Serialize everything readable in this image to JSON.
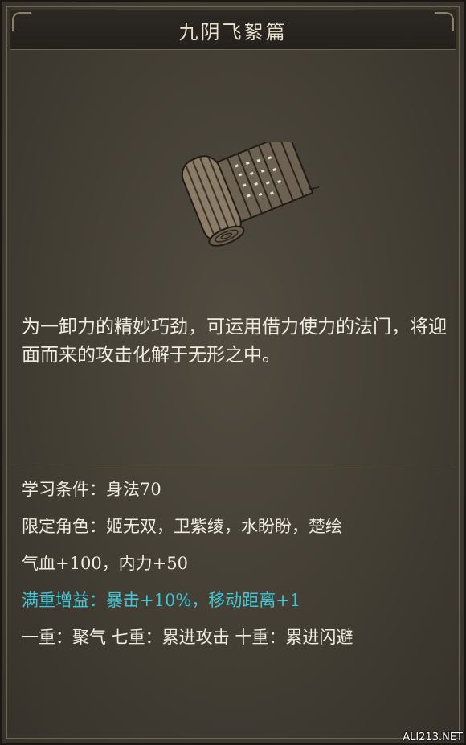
{
  "header": {
    "title": "九阴飞絮篇"
  },
  "item": {
    "icon": "bamboo-scroll-icon",
    "description": "为一卸力的精妙巧劲，可运用借力使力的法门，将迎面而来的攻击化解于无形之中。"
  },
  "stats": {
    "requirement": "学习条件：身法70",
    "roles": "限定角色：姬无双，卫紫绫，水盼盼，楚绘",
    "bonus": "气血+100，内力+50",
    "full_bonus": "满重增益：暴击+10%，移动距离+1",
    "tiers": "一重：聚气 七重：累进攻击 十重：累进闪避"
  },
  "colors": {
    "highlight": "#3fc8d6",
    "text": "#f1ece0"
  },
  "watermark": "ALI213.NET"
}
